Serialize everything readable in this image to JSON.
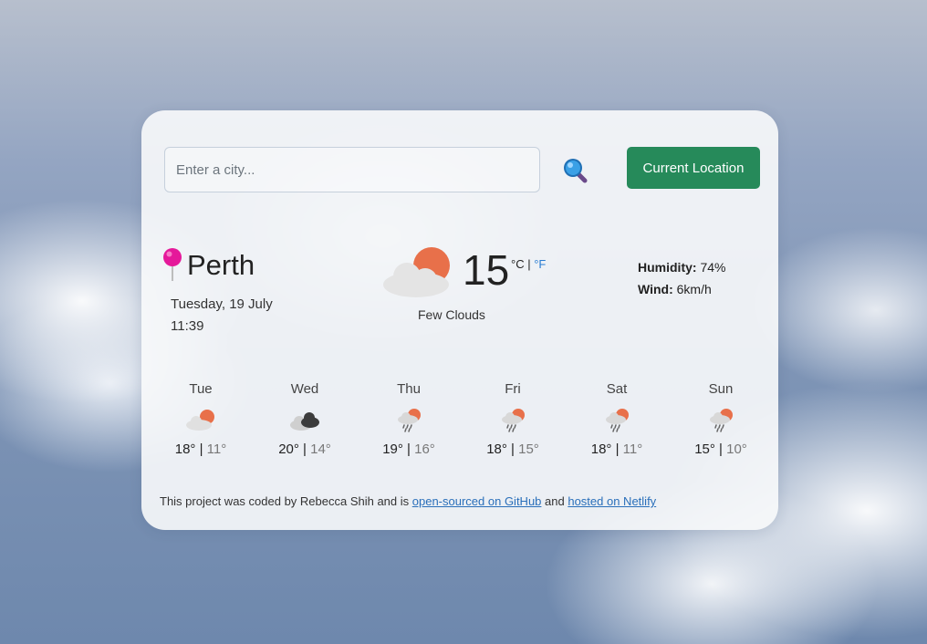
{
  "search": {
    "placeholder": "Enter a city..."
  },
  "buttons": {
    "current_location": "Current Location",
    "search_icon": "magnifier-icon"
  },
  "location": {
    "city": "Perth",
    "date": "Tuesday, 19 July",
    "time": "11:39",
    "pin_icon": "pin-icon",
    "pin_color": "#e5199a"
  },
  "current": {
    "temperature": "15",
    "unit_c": "°C",
    "separator": "|",
    "unit_f": "°F",
    "description": "Few Clouds",
    "icon": "few-clouds-icon",
    "humidity_label": "Humidity:",
    "humidity_value": "74%",
    "wind_label": "Wind:",
    "wind_value": "6km/h"
  },
  "forecast": [
    {
      "day": "Tue",
      "high": "18°",
      "sep": "|",
      "low": "11°",
      "icon": "few-clouds-icon"
    },
    {
      "day": "Wed",
      "high": "20°",
      "sep": "|",
      "low": "14°",
      "icon": "broken-clouds-icon"
    },
    {
      "day": "Thu",
      "high": "19°",
      "sep": "|",
      "low": "16°",
      "icon": "rain-icon"
    },
    {
      "day": "Fri",
      "high": "18°",
      "sep": "|",
      "low": "15°",
      "icon": "rain-icon"
    },
    {
      "day": "Sat",
      "high": "18°",
      "sep": "|",
      "low": "11°",
      "icon": "rain-icon"
    },
    {
      "day": "Sun",
      "high": "15°",
      "sep": "|",
      "low": "10°",
      "icon": "rain-icon"
    }
  ],
  "footer": {
    "text1": "This project was coded by Rebecca Shih and is ",
    "link1": "open-sourced on GitHub",
    "text2": " and ",
    "link2": "hosted on Netlify"
  },
  "colors": {
    "accent_button": "#268a5a",
    "link": "#2a6fba",
    "sun": "#e8704a"
  }
}
